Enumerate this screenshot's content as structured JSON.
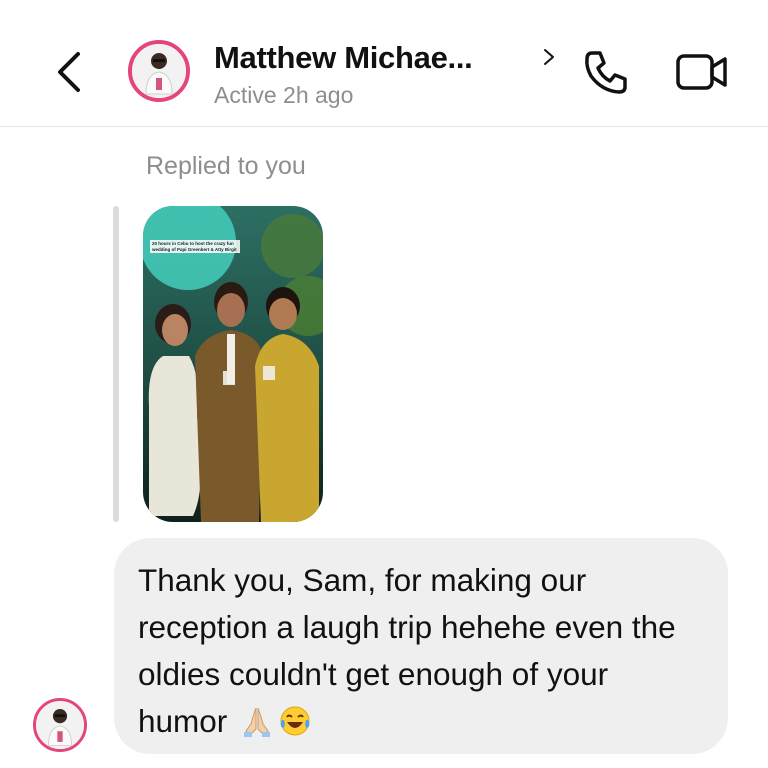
{
  "header": {
    "name": "Matthew Michae...",
    "status": "Active 2h ago",
    "icons": {
      "back": "chevron-left-icon",
      "profile": "chevron-right-icon",
      "call": "phone-icon",
      "video": "video-camera-icon"
    }
  },
  "reply": {
    "label": "Replied to you",
    "story_caption": "20 hours in Cebu to host the crazy fun wedding of Papi Greenbert & Atty Birgit"
  },
  "message": {
    "text": "Thank you, Sam, for making our reception a laugh trip hehehe even the oldies couldn't get enough of your humor",
    "emojis": [
      "folded-hands-icon",
      "tears-of-joy-icon"
    ]
  },
  "colors": {
    "avatar_ring": "#e5457a",
    "bubble": "#efefef",
    "muted_text": "#8e8e8e"
  }
}
